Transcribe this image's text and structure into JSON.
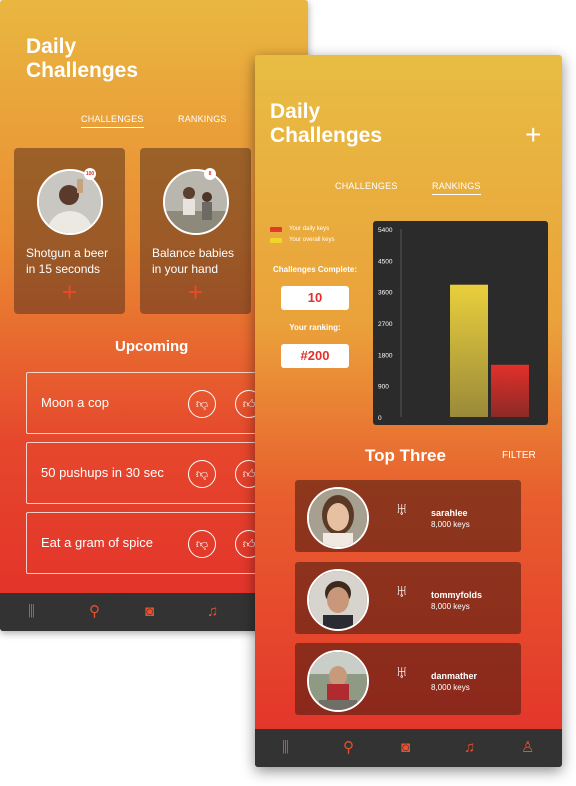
{
  "back_screen": {
    "title_line1": "Daily",
    "title_line2": "Challenges",
    "plus_glyph": "+",
    "tabs": [
      {
        "label": "CHALLENGES",
        "active": true
      },
      {
        "label": "RANKINGS",
        "active": false
      }
    ],
    "cards": [
      {
        "line1": "Shotgun a beer",
        "line2": "in 15 seconds",
        "badge": "100",
        "add_glyph": "+"
      },
      {
        "line1": "Balance babies",
        "line2": "in your hand",
        "badge": "8",
        "add_glyph": "+"
      }
    ],
    "upcoming_title": "Upcoming",
    "upcoming": [
      {
        "label": "Moon a cop"
      },
      {
        "label": "50 pushups in 30 sec"
      },
      {
        "label": "Eat a gram of spice"
      }
    ],
    "tabbar": [
      {
        "icon": "barrels-icon",
        "glyph": "⫼"
      },
      {
        "icon": "trophy-icon",
        "glyph": "⚲"
      },
      {
        "icon": "camera-icon",
        "glyph": "◙"
      },
      {
        "icon": "bell-icon",
        "glyph": "♫"
      }
    ]
  },
  "front_screen": {
    "title_line1": "Daily",
    "title_line2": "Challenges",
    "plus_glyph": "+",
    "tabs": [
      {
        "label": "CHALLENGES",
        "active": false
      },
      {
        "label": "RANKINGS",
        "active": true
      }
    ],
    "legend": [
      {
        "label": "Your daily keys",
        "color": "#e23b2a"
      },
      {
        "label": "Your overall keys",
        "color": "#f0d62a"
      }
    ],
    "challenges_complete_label": "Challenges Complete:",
    "challenges_complete_value": "10",
    "ranking_label": "Your ranking:",
    "ranking_value": "#200",
    "top_three_title": "Top Three",
    "filter_label": "FILTER",
    "top_three": [
      {
        "name": "sarahlee",
        "keys": "8,000 keys"
      },
      {
        "name": "tommyfolds",
        "keys": "8,000 keys"
      },
      {
        "name": "danmather",
        "keys": "8,000 keys"
      }
    ],
    "tabbar": [
      {
        "icon": "barrels-icon",
        "glyph": "⫼"
      },
      {
        "icon": "trophy-icon",
        "glyph": "⚲"
      },
      {
        "icon": "camera-icon",
        "glyph": "◙"
      },
      {
        "icon": "bell-icon",
        "glyph": "♫"
      },
      {
        "icon": "profile-icon",
        "glyph": "♙"
      }
    ]
  },
  "chart_data": {
    "type": "bar",
    "categories": [
      "Your overall keys",
      "Your daily keys"
    ],
    "values": [
      3800,
      1500
    ],
    "colors": [
      "#e9cf3c",
      "#e2302a"
    ],
    "ylim": [
      0,
      5400
    ],
    "yticks": [
      "0",
      "900",
      "1800",
      "2700",
      "3600",
      "4500",
      "5400"
    ],
    "grid": false,
    "background": "#2b2b2b"
  }
}
